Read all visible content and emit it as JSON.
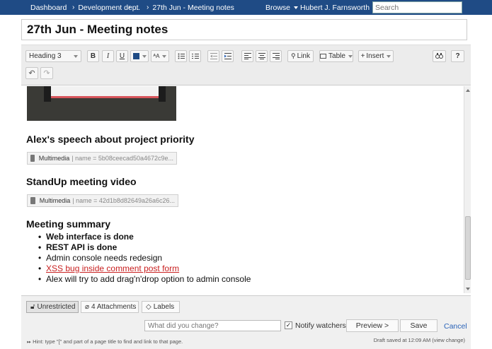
{
  "nav": {
    "breadcrumbs": [
      "Dashboard",
      "Development dept",
      "...",
      "27th Jun - Meeting notes"
    ],
    "browse": "Browse",
    "user": "Hubert J. Farnsworth",
    "search_placeholder": "Search",
    "bg_color": "#1f4b85"
  },
  "page": {
    "title": "27th Jun - Meeting notes"
  },
  "toolbar": {
    "style_select": "Heading 3",
    "bold": "B",
    "italic": "I",
    "underline": "U",
    "text_color": "#1f4b85",
    "more_format": "ᴬA",
    "bullet_list_icon": "bullet-list-icon",
    "numbered_list_icon": "numbered-list-icon",
    "outdent_icon": "outdent-icon",
    "indent_icon": "indent-icon",
    "align_left_icon": "align-left-icon",
    "align_center_icon": "align-center-icon",
    "align_right_icon": "align-right-icon",
    "link": "Link",
    "table": "Table",
    "insert": "Insert",
    "find_icon": "find-replace-icon",
    "help": "?",
    "undo_icon": "undo-icon",
    "redo_icon": "redo-icon"
  },
  "content": {
    "heading_speech": "Alex's speech about project priority",
    "macro1": {
      "label": "Multimedia",
      "params": "| name = 5b08ceecad50a4672c9e..."
    },
    "heading_video": "StandUp meeting video",
    "macro2": {
      "label": "Multimedia",
      "params": "| name = 42d1b8d82649a26a6c26..."
    },
    "heading_summary": "Meeting summary",
    "summary_items": [
      "Web interface is done",
      "REST API is done",
      "Admin console needs redesign",
      "XSS bug inside comment post form",
      "Alex will try to add drag'n'drop option to admin console"
    ]
  },
  "footer": {
    "restrictions": "Unrestricted",
    "attachments": "4 Attachments",
    "labels": "Labels",
    "comment_placeholder": "What did you change?",
    "notify": "Notify watchers",
    "notify_checked": true,
    "preview": "Preview >",
    "save": "Save",
    "cancel": "Cancel",
    "hint": "Hint: type \"[\" and part of a page title to find and link to that page.",
    "draft_saved": "Draft saved at 12:09 AM (view change)"
  }
}
